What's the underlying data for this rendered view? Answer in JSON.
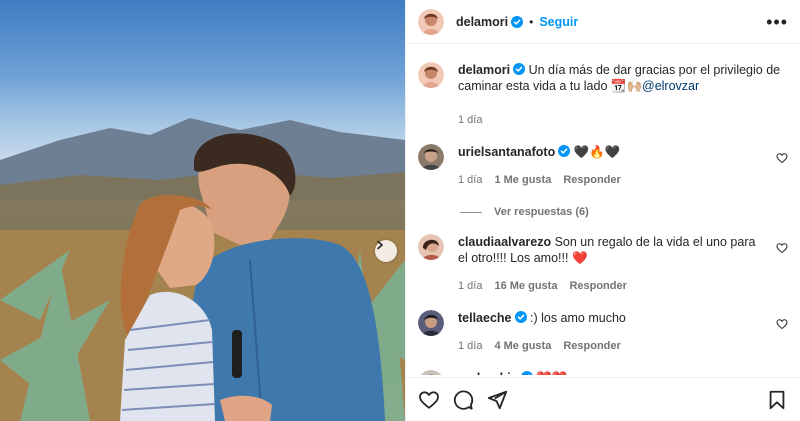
{
  "post": {
    "author": "delamori",
    "follow_label": "Seguir",
    "more_label": "•••"
  },
  "caption": {
    "author": "delamori",
    "text": "Un día más de dar gracias por el privilegio de caminar esta vida a tu lado",
    "mention": "@elrovzar",
    "time": "1 día"
  },
  "comments": [
    {
      "username": "urielsantanafoto",
      "verified": true,
      "text": "🖤🔥🖤",
      "time": "1 día",
      "likes": "1 Me gusta",
      "reply_label": "Responder",
      "view_replies": "Ver respuestas (6)"
    },
    {
      "username": "claudiaalvarezo",
      "verified": false,
      "text": "Son un regalo de la vida el uno para el otro!!!! Los amo!!! ❤️",
      "time": "1 día",
      "likes": "16 Me gusta",
      "reply_label": "Responder"
    },
    {
      "username": "tellaeche",
      "verified": true,
      "text": ":) los amo mucho",
      "time": "1 día",
      "likes": "4 Me gusta",
      "reply_label": "Responder"
    },
    {
      "username": "andruchis",
      "verified": true,
      "text": "❤️❤️"
    }
  ],
  "colors": {
    "accent": "#0095f6",
    "verified": "#0095f6",
    "heart_red": "#ed4956",
    "text_secondary": "#737373"
  },
  "icons": {
    "like": "heart-outline-icon",
    "comment": "comment-bubble-icon",
    "share": "paper-plane-icon",
    "save": "bookmark-icon",
    "next": "chevron-right-icon"
  }
}
